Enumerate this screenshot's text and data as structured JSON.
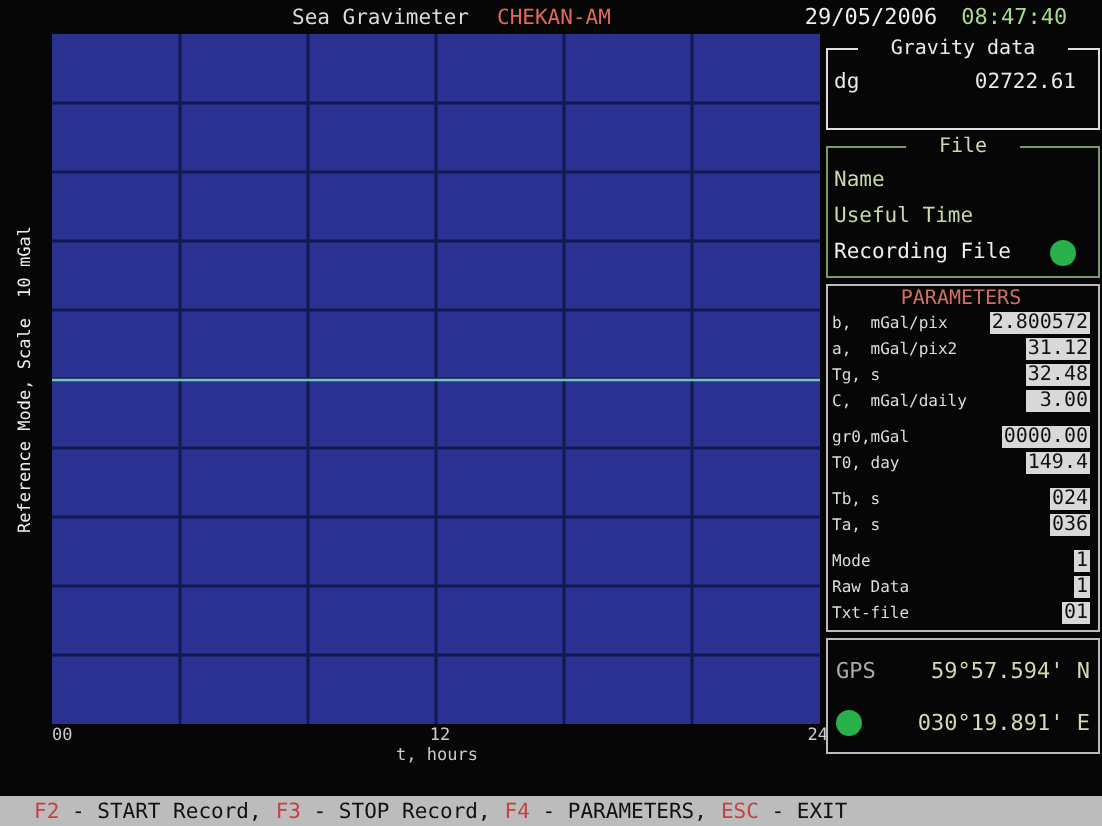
{
  "header": {
    "title": "Sea Gravimeter",
    "device": "CHEKAN-AM",
    "date": "29/05/2006",
    "time": "08:47:40"
  },
  "plot": {
    "ylabel": "Reference Mode, Scale  10 mGal",
    "x_labels": [
      "00",
      "12",
      "24"
    ],
    "xlabel": "t, hours"
  },
  "gravity_data": {
    "title": "Gravity data",
    "label": "dg",
    "value": "02722.61"
  },
  "file": {
    "title": "File",
    "name_label": "Name",
    "useful_time_label": "Useful Time",
    "recording_label": "Recording File",
    "recording": true
  },
  "parameters": {
    "title": "PARAMETERS",
    "groups": [
      [
        {
          "label": "b,  mGal/pix",
          "value": "2.800572"
        },
        {
          "label": "a,  mGal/pix2",
          "value": "31.12"
        },
        {
          "label": "Tg, s",
          "value": "32.48"
        },
        {
          "label": "C,  mGal/daily",
          "value": " 3.00"
        }
      ],
      [
        {
          "label": "gr0,mGal",
          "value": "0000.00"
        },
        {
          "label": "T0, day",
          "value": "149.4"
        }
      ],
      [
        {
          "label": "Tb, s",
          "value": "024"
        },
        {
          "label": "Ta, s",
          "value": "036"
        }
      ],
      [
        {
          "label": "Mode",
          "value": "1"
        },
        {
          "label": "Raw Data",
          "value": "1"
        },
        {
          "label": "Txt-file",
          "value": "01"
        }
      ]
    ]
  },
  "gps": {
    "title": "GPS",
    "fix": true,
    "latitude": "59°57.594' N",
    "longitude": "030°19.891' E"
  },
  "footer": [
    {
      "key": "F2",
      "action": " - START Record,"
    },
    {
      "key": "F3",
      "action": " - STOP Record,"
    },
    {
      "key": "F4",
      "action": " - PARAMETERS,"
    },
    {
      "key": "ESC",
      "action": " - EXIT"
    }
  ]
}
